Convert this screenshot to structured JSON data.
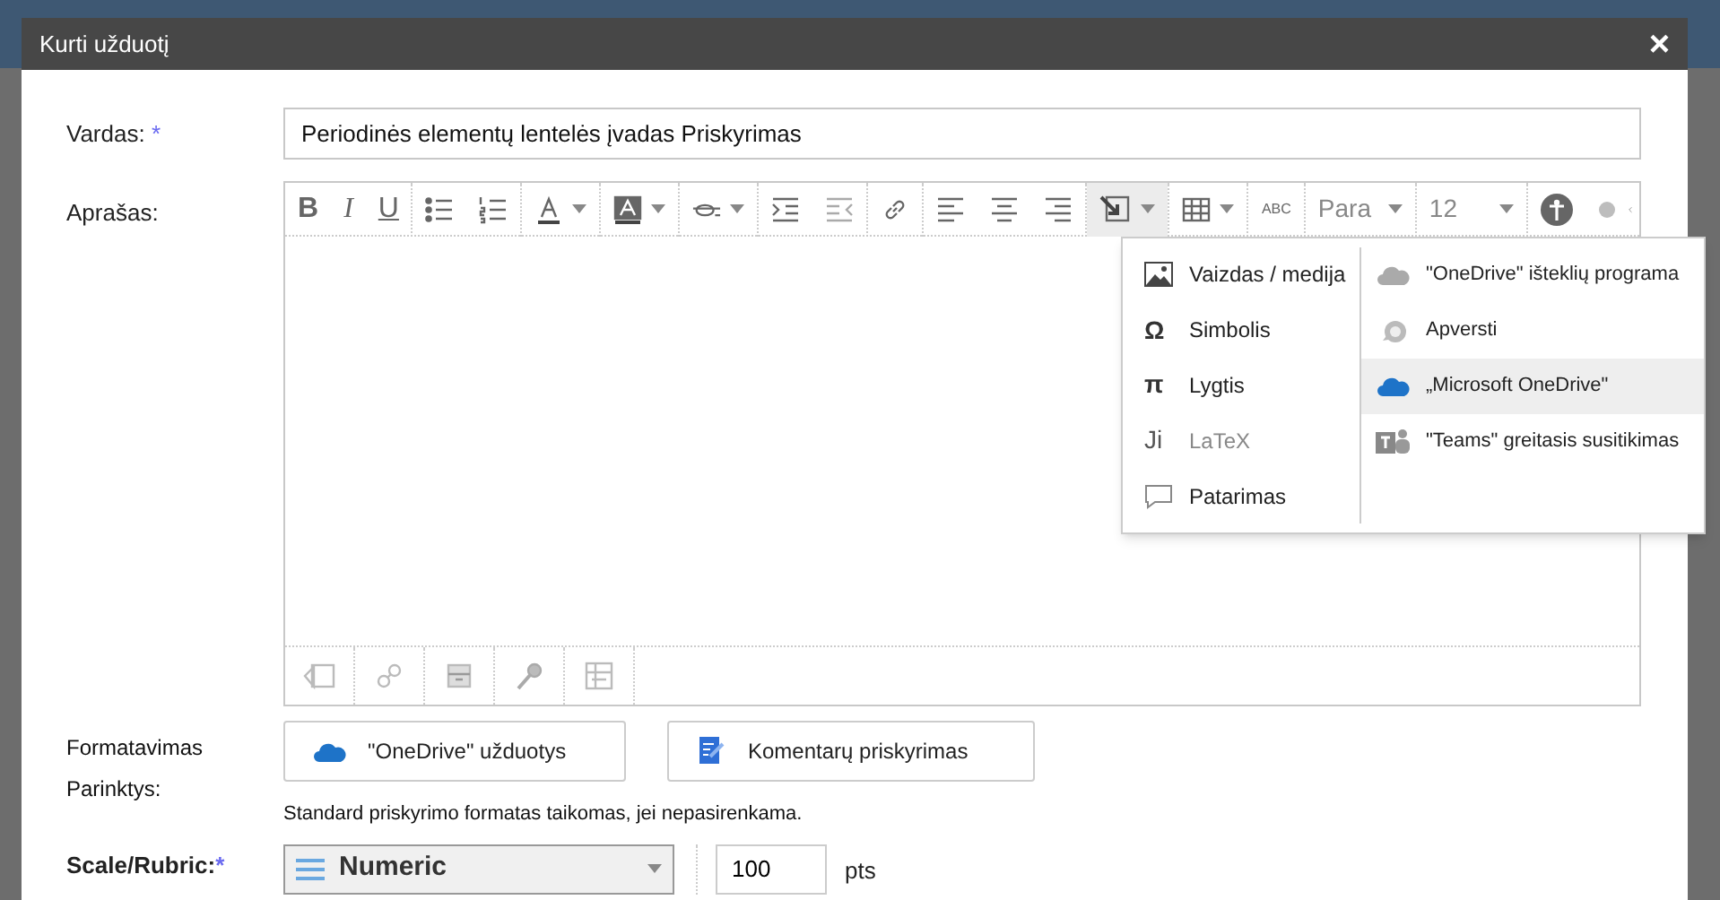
{
  "dialog": {
    "title": "Kurti užduotį",
    "close": "×"
  },
  "name_field": {
    "label": "Vardas:",
    "required": "*",
    "value": "Periodinės elementų lentelės įvadas Priskyrimas"
  },
  "description": {
    "label": "Aprašas:",
    "toolbar": [
      [
        {
          "kind": "bold",
          "label": "B"
        },
        {
          "kind": "italic",
          "label": "I"
        },
        {
          "kind": "underline",
          "label": "U"
        }
      ],
      [
        {
          "kind": "bullets"
        },
        {
          "kind": "numbers"
        }
      ],
      [
        {
          "kind": "font-color"
        }
      ],
      [
        {
          "kind": "highlight"
        }
      ],
      [
        {
          "kind": "script"
        }
      ],
      [
        {
          "kind": "indent"
        },
        {
          "kind": "outdent"
        }
      ],
      [
        {
          "kind": "link"
        }
      ],
      [
        {
          "kind": "align-left"
        },
        {
          "kind": "align-center"
        },
        {
          "kind": "align-right"
        }
      ],
      [
        {
          "kind": "insert",
          "selected": true
        }
      ],
      [
        {
          "kind": "table"
        }
      ],
      [
        {
          "kind": "spellcheck",
          "label": "ABC"
        }
      ],
      [
        {
          "kind": "select",
          "label": "Para"
        }
      ],
      [
        {
          "kind": "select",
          "label": "12"
        }
      ],
      [
        {
          "kind": "accessibility"
        },
        {
          "kind": "dot"
        }
      ]
    ],
    "bottom_tools": [
      {
        "kind": "media"
      },
      {
        "kind": "chain"
      },
      {
        "kind": "archive"
      },
      {
        "kind": "mic"
      },
      {
        "kind": "grid"
      }
    ],
    "menu": {
      "left": [
        {
          "kind": "image",
          "label": "Vaizdas / medija",
          "disabled": false
        },
        {
          "kind": "glyph",
          "glyph": "Ω",
          "label": "Simbolis",
          "disabled": false
        },
        {
          "kind": "glyph",
          "glyph": "π",
          "label": "Lygtis",
          "disabled": false
        },
        {
          "kind": "glyph",
          "glyph": "Ji",
          "label": "LaTeX",
          "disabled": true
        },
        {
          "kind": "bubble",
          "label": "Patarimas",
          "disabled": false
        }
      ],
      "right": [
        {
          "kind": "cloud-grey",
          "label": "\"OneDrive\" išteklių programa",
          "selected": false
        },
        {
          "kind": "flip",
          "label": "Apversti",
          "selected": false
        },
        {
          "kind": "cloud-blue",
          "label": "„Microsoft OneDrive\"",
          "selected": true
        },
        {
          "kind": "teams",
          "label": "\"Teams\" greitasis susitikimas",
          "selected": false
        }
      ]
    }
  },
  "format": {
    "label_lines": [
      "Formatavimas",
      "Parinktys:"
    ],
    "buttons": [
      {
        "kind": "cloud",
        "label": "\"OneDrive\" užduotys"
      },
      {
        "kind": "document",
        "label": "Komentarų priskyrimas"
      }
    ],
    "hint": "Standard priskyrimo formatas taikomas, jei nepasirenkama."
  },
  "scale": {
    "label": "Scale/Rubric:",
    "required": "*",
    "value": "Numeric",
    "points": "100",
    "unit": "pts"
  }
}
